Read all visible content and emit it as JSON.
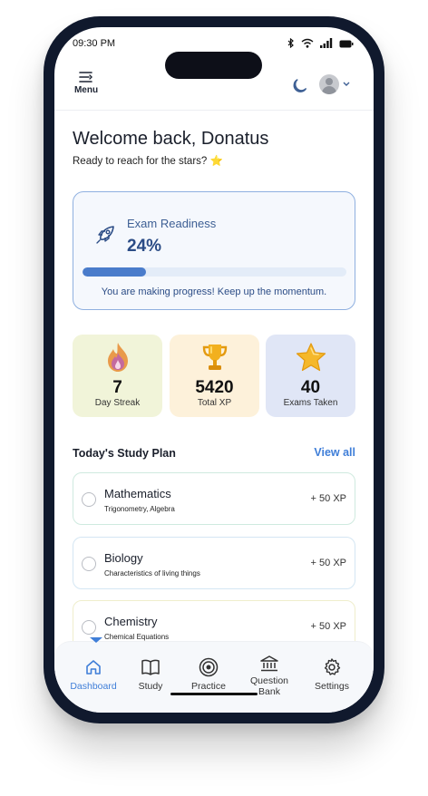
{
  "status_bar": {
    "time": "09:30 PM"
  },
  "header": {
    "menu_label": "Menu"
  },
  "welcome": {
    "title": "Welcome back, Donatus",
    "subtitle": "Ready to reach for the stars? ⭐"
  },
  "readiness": {
    "label": "Exam Readiness",
    "value": "24%",
    "progress_fraction": 0.24,
    "message": "You are making progress! Keep up the momentum."
  },
  "stats": [
    {
      "value": "7",
      "label": "Day Streak",
      "icon": "flame-icon"
    },
    {
      "value": "5420",
      "label": "Total XP",
      "icon": "trophy-icon"
    },
    {
      "value": "40",
      "label": "Exams Taken",
      "icon": "star-icon"
    }
  ],
  "study_plan": {
    "title": "Today's Study Plan",
    "view_all": "View all",
    "tasks": [
      {
        "title": "Mathematics",
        "subtitle": "Trigonometry, Algebra",
        "xp": "+ 50 XP"
      },
      {
        "title": "Biology",
        "subtitle": "Characteristics of living things",
        "xp": "+ 50 XP"
      },
      {
        "title": "Chemistry",
        "subtitle": "Chemical Equations",
        "xp": "+ 50 XP"
      }
    ]
  },
  "nav": {
    "dashboard": "Dashboard",
    "study": "Study",
    "practice": "Practice",
    "question_bank_line1": "Question",
    "question_bank_line2": "Bank",
    "settings": "Settings"
  },
  "colors": {
    "accent": "#3f7ed8",
    "readiness_border": "#8fb0e0",
    "phone_frame": "#10192d"
  }
}
